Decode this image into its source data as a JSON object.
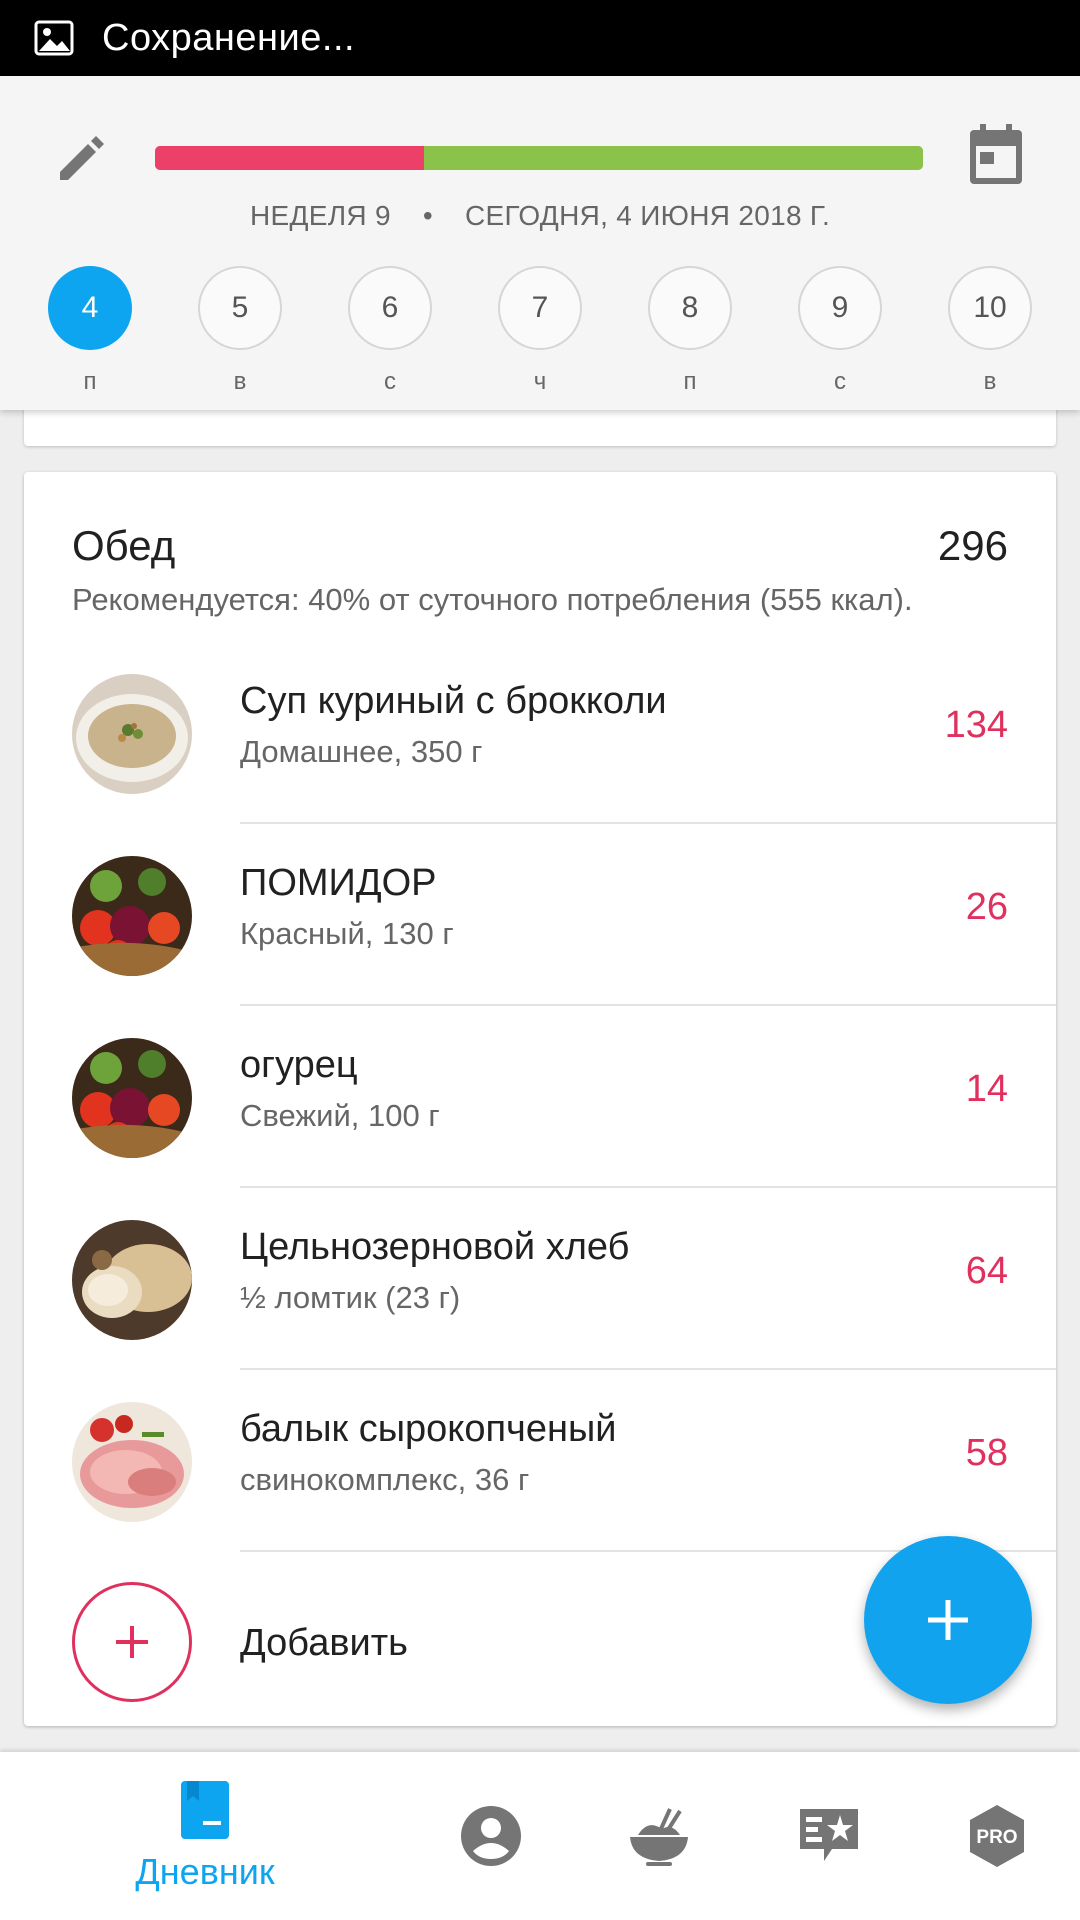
{
  "status_bar": {
    "text": "Сохранение..."
  },
  "header": {
    "progress_fraction": 0.35,
    "week_label": "НЕДЕЛЯ 9",
    "separator": "•",
    "today_label": "СЕГОДНЯ, 4 ИЮНЯ 2018 Г.",
    "days": [
      {
        "num": "4",
        "weekday": "п",
        "selected": true
      },
      {
        "num": "5",
        "weekday": "в",
        "selected": false
      },
      {
        "num": "6",
        "weekday": "с",
        "selected": false
      },
      {
        "num": "7",
        "weekday": "ч",
        "selected": false
      },
      {
        "num": "8",
        "weekday": "п",
        "selected": false
      },
      {
        "num": "9",
        "weekday": "с",
        "selected": false
      },
      {
        "num": "10",
        "weekday": "в",
        "selected": false
      }
    ],
    "colors": {
      "progress_consumed": "#ec4068",
      "progress_remaining": "#8bc34a",
      "accent": "#0ea5f0"
    }
  },
  "meal": {
    "title": "Обед",
    "total": "296",
    "recommendation": "Рекомендуется: 40% от суточного потребления (555 ккал).",
    "items": [
      {
        "name": "Суп куриный с брокколи",
        "details": "Домашнее, 350 г",
        "kcal": "134",
        "thumb": "soup"
      },
      {
        "name": "ПОМИДОР",
        "details": "Красный, 130 г",
        "kcal": "26",
        "thumb": "vegetables"
      },
      {
        "name": "огурец",
        "details": "Свежий, 100 г",
        "kcal": "14",
        "thumb": "vegetables"
      },
      {
        "name": "Цельнозерновой хлеб",
        "details": "½ ломтик (23 г)",
        "kcal": "64",
        "thumb": "bread"
      },
      {
        "name": "балык сырокопченый",
        "details": "свинокомплекс, 36 г",
        "kcal": "58",
        "thumb": "ham"
      }
    ],
    "add_label": "Добавить",
    "kcal_color": "#e0305e"
  },
  "bottom_nav": {
    "items": [
      {
        "icon": "diary-book-icon",
        "label": "Дневник",
        "active": true
      },
      {
        "icon": "profile-icon",
        "label": "",
        "active": false
      },
      {
        "icon": "food-bowl-icon",
        "label": "",
        "active": false
      },
      {
        "icon": "recipes-star-icon",
        "label": "",
        "active": false
      },
      {
        "icon": "pro-badge-icon",
        "label": "",
        "active": false
      }
    ],
    "pro_text": "PRO"
  }
}
